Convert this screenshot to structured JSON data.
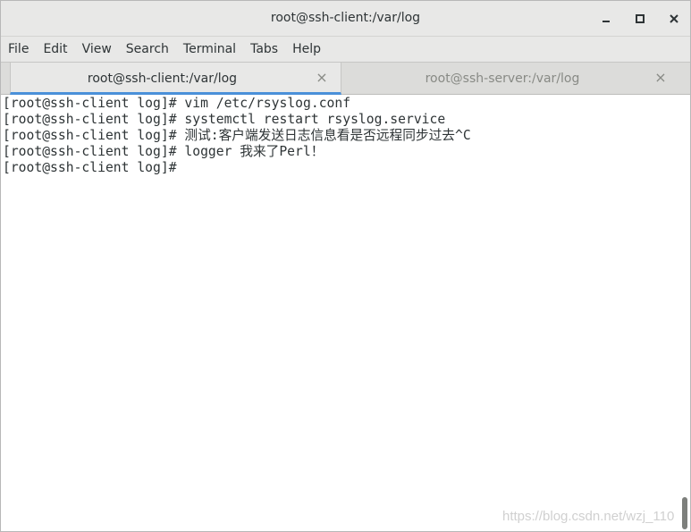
{
  "window": {
    "title": "root@ssh-client:/var/log"
  },
  "menu": [
    "File",
    "Edit",
    "View",
    "Search",
    "Terminal",
    "Tabs",
    "Help"
  ],
  "tabs": [
    {
      "label": "root@ssh-client:/var/log",
      "active": true,
      "close": "×"
    },
    {
      "label": "root@ssh-server:/var/log",
      "active": false,
      "close": "×"
    }
  ],
  "terminal": {
    "lines": [
      "[root@ssh-client log]# vim /etc/rsyslog.conf",
      "[root@ssh-client log]# systemctl restart rsyslog.service",
      "[root@ssh-client log]# 测试:客户端发送日志信息看是否远程同步过去^C",
      "[root@ssh-client log]# logger 我来了Perl！",
      "[root@ssh-client log]# "
    ]
  },
  "watermark": "https://blog.csdn.net/wzj_110",
  "icons": {
    "minimize": "minimize-icon",
    "maximize": "maximize-icon",
    "close": "close-icon"
  },
  "colors": {
    "active_tab_underline": "#4a90d9",
    "chrome_bg": "#e8e8e7",
    "text": "#2e3436"
  }
}
